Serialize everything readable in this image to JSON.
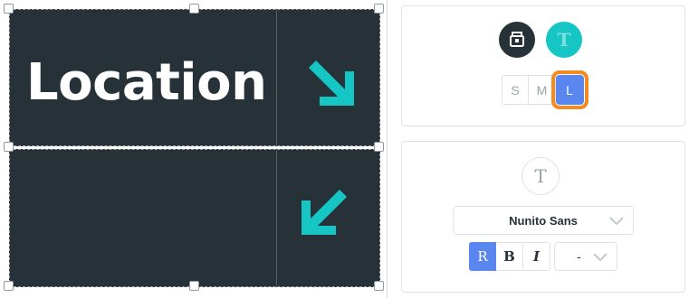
{
  "canvas": {
    "heading_text": "Location",
    "panel_color": "#263238",
    "arrow_color": "#15c6c4"
  },
  "style_card": {
    "style_icon": "paint-bucket-icon",
    "text_icon": "text-t-icon",
    "sizes": [
      "S",
      "M",
      "L"
    ],
    "selected_size": "L",
    "highlight_color": "#f58a1f",
    "active_color": "#5a86f0"
  },
  "text_card": {
    "text_icon_glyph": "T",
    "font_family_value": "Nunito Sans",
    "format_buttons": [
      "R",
      "B",
      "I"
    ],
    "selected_format": "R",
    "spacing_value": "-"
  }
}
